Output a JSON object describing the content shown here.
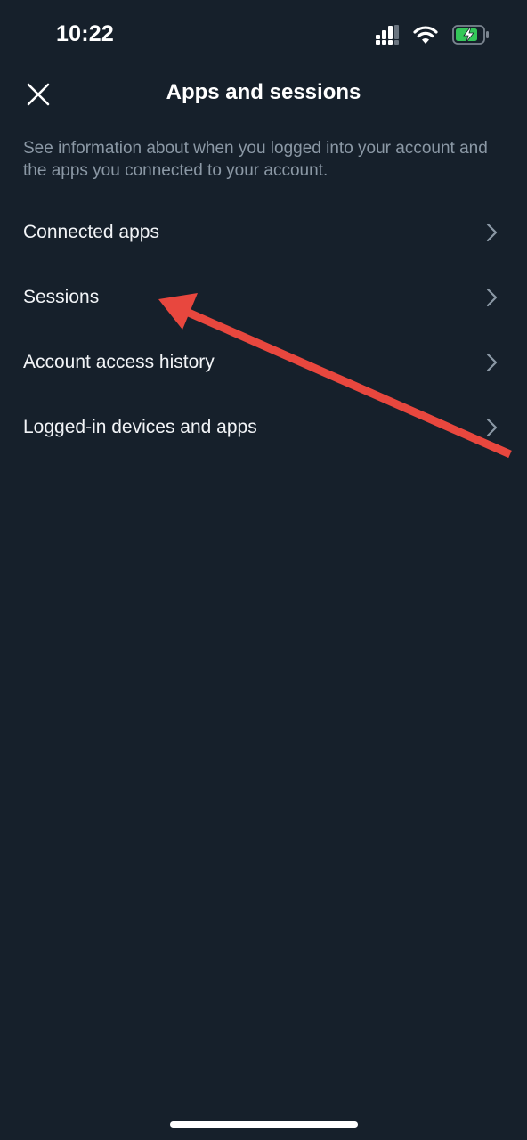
{
  "status_bar": {
    "time": "10:22",
    "icons": [
      "cellular-signal-icon",
      "wifi-icon",
      "battery-charging-icon"
    ],
    "battery_color": "#34c759"
  },
  "header": {
    "title": "Apps and sessions",
    "close_icon": "close-icon"
  },
  "description": "See information about when you logged into your account and the apps you connected to your account.",
  "menu": {
    "items": [
      {
        "label": "Connected apps",
        "icon": "chevron-right-icon"
      },
      {
        "label": "Sessions",
        "icon": "chevron-right-icon"
      },
      {
        "label": "Account access history",
        "icon": "chevron-right-icon"
      },
      {
        "label": "Logged-in devices and apps",
        "icon": "chevron-right-icon"
      }
    ]
  },
  "annotation": {
    "type": "arrow",
    "color": "#e8473e",
    "points_to": "Sessions"
  },
  "colors": {
    "background": "#16202b",
    "text_primary": "#f2f4f7",
    "text_secondary": "#8b98a5",
    "chevron": "#8b98a5"
  }
}
